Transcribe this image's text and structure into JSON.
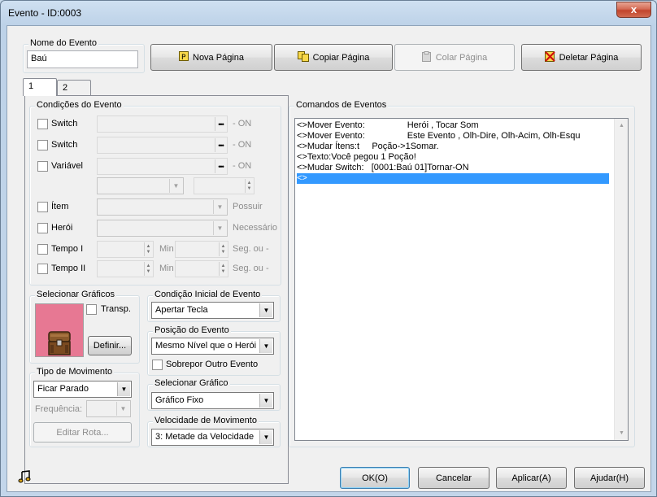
{
  "window": {
    "title": "Evento - ID:0003",
    "close_glyph": "x"
  },
  "event_name": {
    "label": "Nome do Evento",
    "value": "Baú"
  },
  "page_buttons": {
    "new": "Nova Página",
    "copy": "Copiar Página",
    "paste": "Colar Página",
    "delete": "Deletar Página"
  },
  "tabs": [
    "1",
    "2"
  ],
  "conditions": {
    "title": "Condições do Evento",
    "switch1": {
      "label": "Switch",
      "suffix": "- ON"
    },
    "switch2": {
      "label": "Switch",
      "suffix": "- ON"
    },
    "variable": {
      "label": "Variável",
      "suffix": "- ON"
    },
    "item": {
      "label": "Ítem",
      "suffix": "Possuir"
    },
    "hero": {
      "label": "Herói",
      "suffix": "Necessário"
    },
    "timer1": {
      "label": "Tempo I",
      "min": "Min",
      "sec": "Seg. ou -"
    },
    "timer2": {
      "label": "Tempo II",
      "min": "Min",
      "sec": "Seg. ou -"
    }
  },
  "graphics": {
    "title": "Selecionar Gráficos",
    "transparent_label": "Transp.",
    "define_button": "Definir...",
    "sprite_bg": "#e77893"
  },
  "start_condition": {
    "title": "Condição Inicial de Evento",
    "value": "Apertar Tecla"
  },
  "event_position": {
    "title": "Posição do Evento",
    "value": "Mesmo Nível que o Herói",
    "overlap_label": "Sobrepor Outro Evento"
  },
  "movement_type": {
    "title": "Tipo de Movimento",
    "value": "Ficar Parado",
    "frequency_label": "Frequência:",
    "edit_route_button": "Editar Rota..."
  },
  "select_graphic": {
    "title": "Selecionar Gráfico",
    "value": "Gráfico Fixo"
  },
  "move_speed": {
    "title": "Velocidade de Movimento",
    "value": "3: Metade da Velocidade"
  },
  "commands": {
    "title": "Comandos de Eventos",
    "lines": [
      "<>Mover Evento:                 Herói , Tocar Som",
      "<>Mover Evento:                 Este Evento , Olh-Dire, Olh-Acim, Olh-Esqu",
      "<>Mudar Ítens:t     Poção->1Somar.",
      "<>Texto:Você pegou 1 Poção!",
      "<>Mudar Switch:   [0001:Baú 01]Tornar-ON",
      "<>"
    ],
    "selected_index": 5
  },
  "footer": {
    "ok": "OK(O)",
    "cancel": "Cancelar",
    "apply": "Aplicar(A)",
    "help": "Ajudar(H)"
  }
}
